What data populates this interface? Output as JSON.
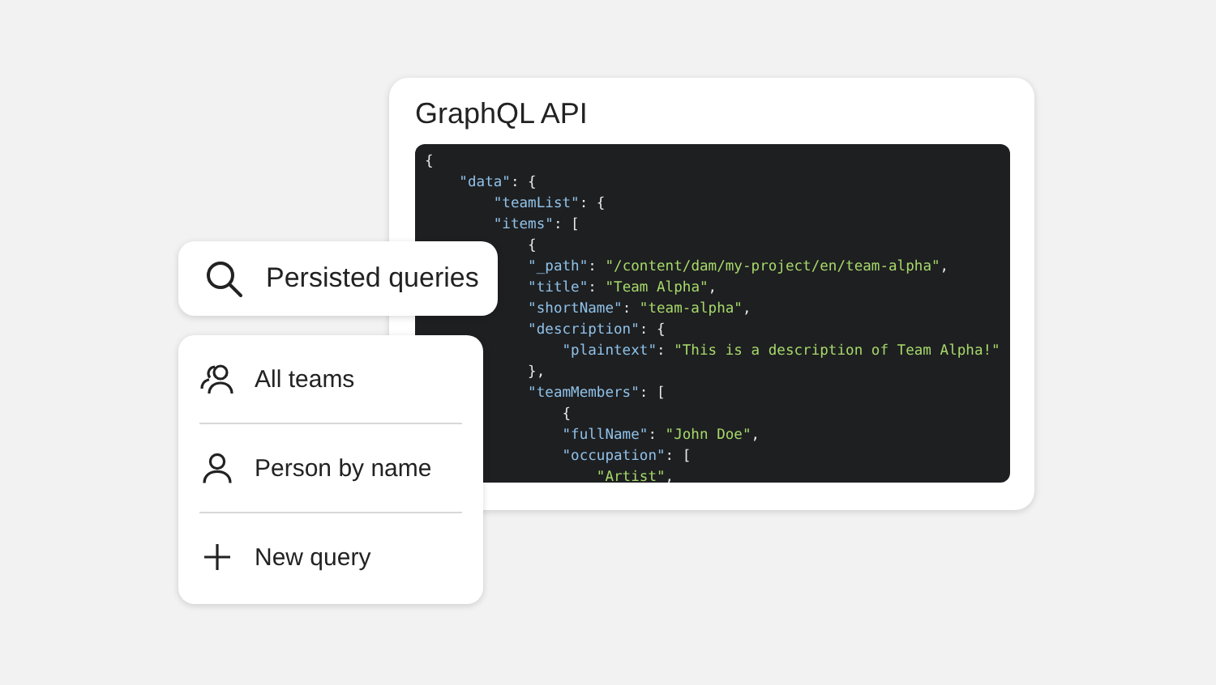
{
  "api_panel": {
    "title": "GraphQL API",
    "code_lines": [
      [
        {
          "kind": "punct",
          "text": "{"
        }
      ],
      [
        {
          "kind": "key",
          "text": "    \"data\""
        },
        {
          "kind": "punct",
          "text": ": {"
        }
      ],
      [
        {
          "kind": "key",
          "text": "        \"teamList\""
        },
        {
          "kind": "punct",
          "text": ": {"
        }
      ],
      [
        {
          "kind": "key",
          "text": "        \"items\""
        },
        {
          "kind": "punct",
          "text": ": ["
        }
      ],
      [
        {
          "kind": "punct",
          "text": "            {"
        }
      ],
      [
        {
          "kind": "key",
          "text": "            \"_path\""
        },
        {
          "kind": "punct",
          "text": ": "
        },
        {
          "kind": "string",
          "text": "\"/content/dam/my-project/en/team-alpha\""
        },
        {
          "kind": "punct",
          "text": ","
        }
      ],
      [
        {
          "kind": "key",
          "text": "            \"title\""
        },
        {
          "kind": "punct",
          "text": ": "
        },
        {
          "kind": "string",
          "text": "\"Team Alpha\""
        },
        {
          "kind": "punct",
          "text": ","
        }
      ],
      [
        {
          "kind": "key",
          "text": "            \"shortName\""
        },
        {
          "kind": "punct",
          "text": ": "
        },
        {
          "kind": "string",
          "text": "\"team-alpha\""
        },
        {
          "kind": "punct",
          "text": ","
        }
      ],
      [
        {
          "kind": "key",
          "text": "            \"description\""
        },
        {
          "kind": "punct",
          "text": ": {"
        }
      ],
      [
        {
          "kind": "key",
          "text": "                \"plaintext\""
        },
        {
          "kind": "punct",
          "text": ": "
        },
        {
          "kind": "string",
          "text": "\"This is a description of Team Alpha!\""
        }
      ],
      [
        {
          "kind": "punct",
          "text": "            },"
        }
      ],
      [
        {
          "kind": "key",
          "text": "            \"teamMembers\""
        },
        {
          "kind": "punct",
          "text": ": ["
        }
      ],
      [
        {
          "kind": "punct",
          "text": "                {"
        }
      ],
      [
        {
          "kind": "key",
          "text": "                \"fullName\""
        },
        {
          "kind": "punct",
          "text": ": "
        },
        {
          "kind": "string",
          "text": "\"John Doe\""
        },
        {
          "kind": "punct",
          "text": ","
        }
      ],
      [
        {
          "kind": "key",
          "text": "                \"occupation\""
        },
        {
          "kind": "punct",
          "text": ": ["
        }
      ],
      [
        {
          "kind": "string",
          "text": "                    \"Artist\""
        },
        {
          "kind": "punct",
          "text": ","
        }
      ]
    ]
  },
  "search": {
    "value": "Persisted queries"
  },
  "menu": {
    "items": [
      {
        "kind": "group",
        "label": "All teams"
      },
      {
        "kind": "person",
        "label": "Person by name"
      },
      {
        "kind": "add",
        "label": "New query"
      }
    ]
  }
}
